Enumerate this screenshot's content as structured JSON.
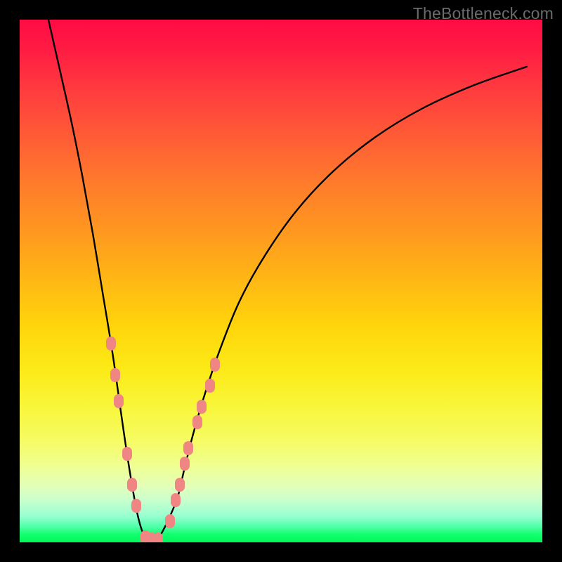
{
  "watermark": "TheBottleneck.com",
  "chart_data": {
    "type": "line",
    "title": "",
    "xlabel": "",
    "ylabel": "",
    "xlim": [
      0,
      100
    ],
    "ylim": [
      0,
      100
    ],
    "grid": false,
    "background_gradient": [
      {
        "stop": 0,
        "color": "#ff0b44"
      },
      {
        "stop": 50,
        "color": "#ffb814"
      },
      {
        "stop": 80,
        "color": "#f6fb5f"
      },
      {
        "stop": 100,
        "color": "#00f85a"
      }
    ],
    "series": [
      {
        "name": "bottleneck-curve",
        "color": "#000000",
        "x": [
          5.5,
          8,
          10,
          12,
          14,
          16,
          17.8,
          19.5,
          21,
          22.4,
          23.5,
          24.5,
          25.5,
          27,
          30,
          31.5,
          33,
          35,
          38,
          42,
          47,
          53,
          60,
          68,
          77,
          87,
          97
        ],
        "y": [
          100,
          89,
          80,
          70,
          59,
          47,
          36,
          24,
          14,
          6,
          2,
          0.5,
          0.5,
          1.5,
          8,
          14,
          20,
          27,
          36,
          46,
          55,
          63.5,
          71,
          77.5,
          83,
          87.5,
          91
        ]
      }
    ],
    "markers": {
      "name": "highlight-dots",
      "color": "#ef8683",
      "points": [
        {
          "x": 17.5,
          "y": 38
        },
        {
          "x": 18.3,
          "y": 32
        },
        {
          "x": 19.0,
          "y": 27
        },
        {
          "x": 20.5,
          "y": 17
        },
        {
          "x": 21.5,
          "y": 11
        },
        {
          "x": 22.3,
          "y": 7
        },
        {
          "x": 24.0,
          "y": 1
        },
        {
          "x": 25.3,
          "y": 0.5
        },
        {
          "x": 26.5,
          "y": 0.5
        },
        {
          "x": 28.7,
          "y": 4
        },
        {
          "x": 29.8,
          "y": 8
        },
        {
          "x": 30.7,
          "y": 11
        },
        {
          "x": 31.6,
          "y": 15
        },
        {
          "x": 32.3,
          "y": 18
        },
        {
          "x": 34.0,
          "y": 23
        },
        {
          "x": 34.8,
          "y": 26
        },
        {
          "x": 36.4,
          "y": 30
        },
        {
          "x": 37.3,
          "y": 34
        }
      ]
    }
  }
}
